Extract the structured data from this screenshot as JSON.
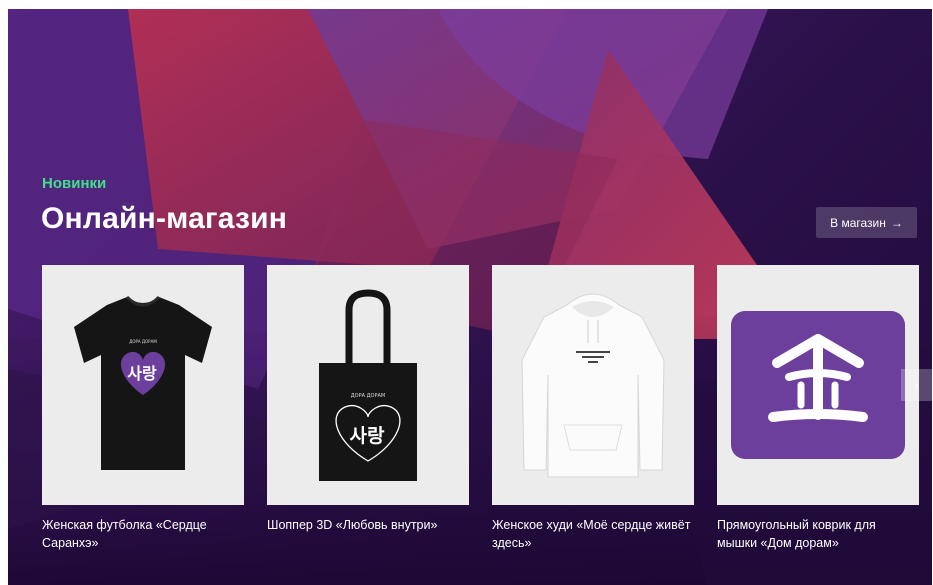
{
  "section": {
    "eyebrow": "Новинки",
    "title": "Онлайн-магазин",
    "shop_button": "В магазин",
    "shop_button_icon": "arrow-right-icon"
  },
  "products": [
    {
      "title": "Женская футболка «Сердце Саранхэ»",
      "print_text": "사랑",
      "brand_text": "ДОРА ДОРАМ",
      "image": "black-tshirt"
    },
    {
      "title": "Шоппер 3D «Любовь внутри»",
      "print_text": "사랑",
      "brand_text": "ДОРА ДОРАМ",
      "image": "black-tote-bag"
    },
    {
      "title": "Женское худи «Моё сердце живёт здесь»",
      "image": "white-hoodie"
    },
    {
      "title": "Прямоугольный коврик для мышки «Дом дорам»",
      "image": "purple-mousepad"
    }
  ],
  "carousel": {
    "next_icon": "chevron-right-icon"
  },
  "colors": {
    "accent_green": "#3ee08a",
    "background_purple": "#3a165e",
    "print_purple": "#6d3f9c",
    "card_background": "#ececec"
  }
}
